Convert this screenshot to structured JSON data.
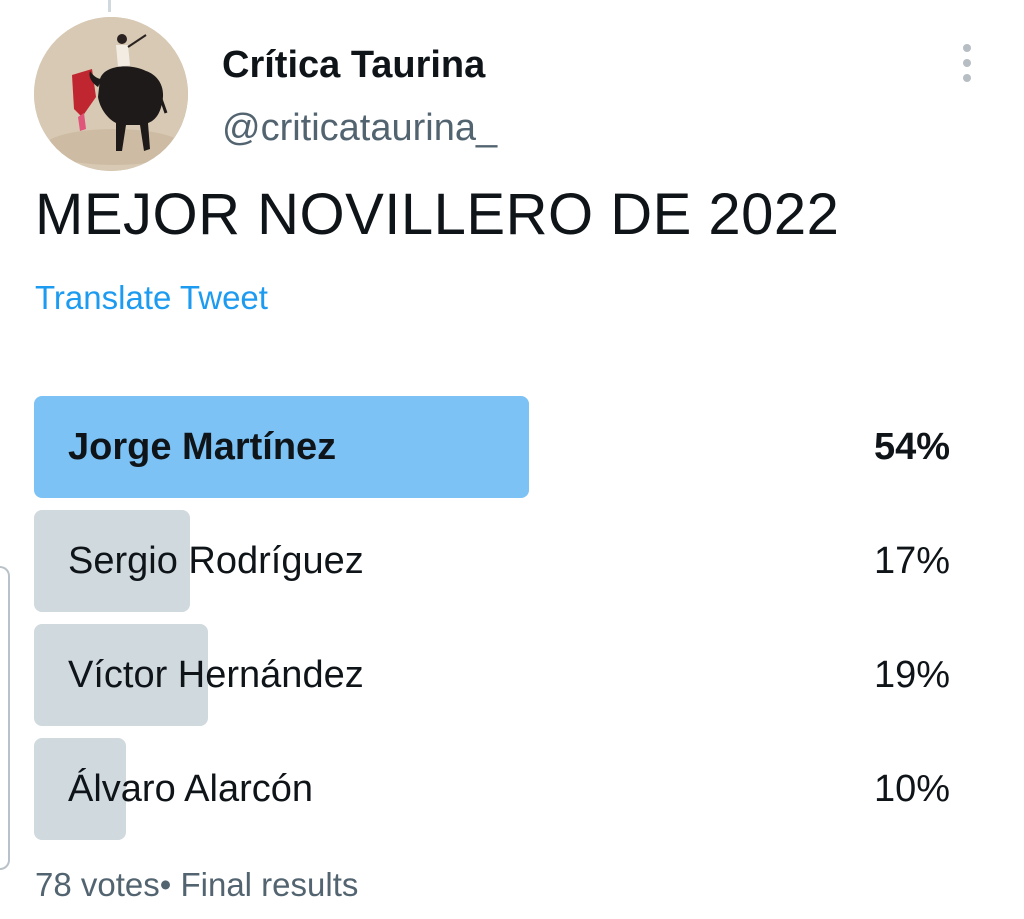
{
  "author": {
    "display_name": "Crítica Taurina",
    "handle": "@criticataurina_",
    "avatar_icon": "bullfighter-photo-avatar"
  },
  "tweet": {
    "text": "MEJOR NOVILLERO DE 2022",
    "translate_label": "Translate Tweet"
  },
  "poll": {
    "options": [
      {
        "label": "Jorge Martínez",
        "percent_text": "54%",
        "percent": 54,
        "winner": true
      },
      {
        "label": "Sergio Rodríguez",
        "percent_text": "17%",
        "percent": 17,
        "winner": false
      },
      {
        "label": "Víctor Hernández",
        "percent_text": "19%",
        "percent": 19,
        "winner": false
      },
      {
        "label": "Álvaro Alarcón",
        "percent_text": "10%",
        "percent": 10,
        "winner": false
      }
    ],
    "votes_text": "78 votes",
    "separator": "•",
    "status_text": "Final results"
  },
  "colors": {
    "winner_bar": "#7cc2f5",
    "other_bar": "#cfd9de",
    "link": "#1d9bf0",
    "secondary_text": "#536471"
  }
}
